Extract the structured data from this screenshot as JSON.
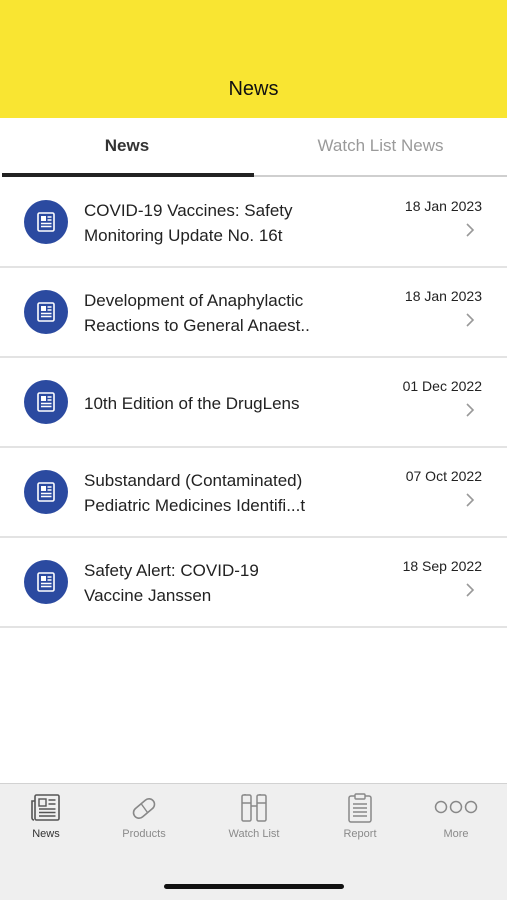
{
  "header": {
    "title": "News"
  },
  "tabs": [
    {
      "label": "News",
      "active": true
    },
    {
      "label": "Watch List News",
      "active": false
    }
  ],
  "news": [
    {
      "line1": "COVID-19 Vaccines: Safety",
      "line2": "Monitoring Update No. 16t",
      "date": "18 Jan 2023"
    },
    {
      "line1": "Development of Anaphylactic",
      "line2": "Reactions to General Anaest..",
      "date": "18 Jan 2023"
    },
    {
      "line1": "10th Edition of the DrugLens",
      "line2": "",
      "date": "01 Dec 2022"
    },
    {
      "line1": "Substandard (Contaminated)",
      "line2": "Pediatric Medicines Identifi...t",
      "date": "07 Oct 2022"
    },
    {
      "line1": "Safety Alert: COVID-19",
      "line2": "Vaccine Janssen",
      "date": "18 Sep 2022"
    }
  ],
  "tabbar": [
    {
      "label": "News",
      "icon": "newspaper-icon",
      "active": true
    },
    {
      "label": "Products",
      "icon": "pill-icon",
      "active": false
    },
    {
      "label": "Watch List",
      "icon": "binoculars-icon",
      "active": false
    },
    {
      "label": "Report",
      "icon": "clipboard-icon",
      "active": false
    },
    {
      "label": "More",
      "icon": "more-dots-icon",
      "active": false
    }
  ],
  "colors": {
    "header_bg": "#f9e532",
    "icon_circle": "#2b4aa0",
    "active_tab_underline": "#222222"
  }
}
